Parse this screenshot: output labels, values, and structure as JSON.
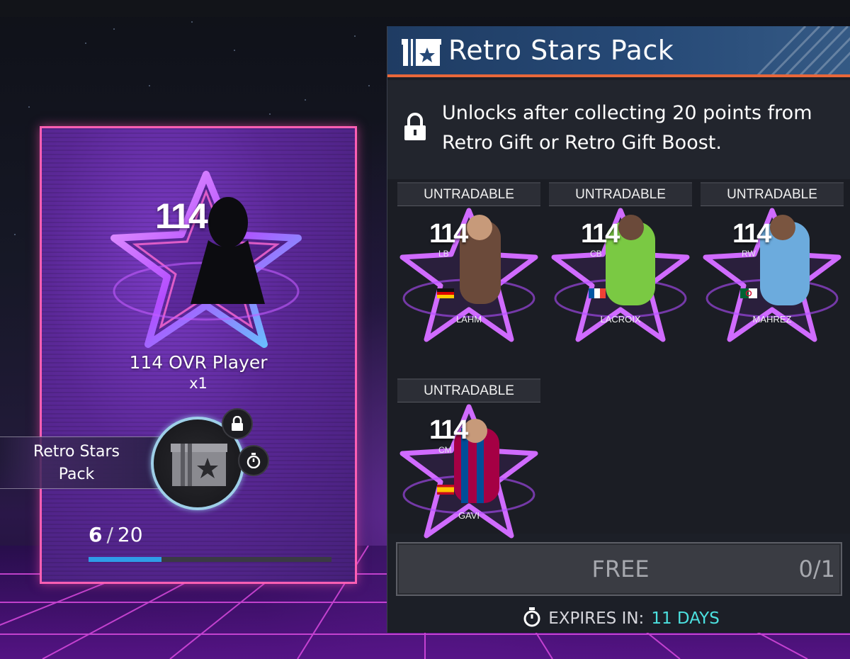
{
  "reward": {
    "rating": "114",
    "title": "114 OVR Player",
    "count": "x1"
  },
  "pack_badge": {
    "line1": "Retro Stars",
    "line2": "Pack"
  },
  "progress": {
    "current": "6",
    "separator": "/",
    "total": "20",
    "fraction": 0.3
  },
  "panel": {
    "title": "Retro Stars Pack",
    "unlock_text": "Unlocks after collecting 20 points from Retro Gift or Retro Gift Boost.",
    "free_label": "FREE",
    "limit": "0/1",
    "expires_label": "EXPIRES IN:",
    "expires_value": "11 DAYS"
  },
  "players": [
    {
      "tag": "UNTRADABLE",
      "rating": "114",
      "position": "LB",
      "name": "LAHM",
      "flag": "germany"
    },
    {
      "tag": "UNTRADABLE",
      "rating": "114",
      "position": "CB",
      "name": "LACROIX",
      "flag": "france"
    },
    {
      "tag": "UNTRADABLE",
      "rating": "114",
      "position": "RW",
      "name": "MAHREZ",
      "flag": "algeria"
    },
    {
      "tag": "UNTRADABLE",
      "rating": "114",
      "position": "CM",
      "name": "GAVI",
      "flag": "spain"
    }
  ],
  "colors": {
    "card_border": "#ff5fb3",
    "header_accent": "#e8673a",
    "expires_value": "#4ce0df",
    "progress_fill": "#2f9ce8"
  }
}
